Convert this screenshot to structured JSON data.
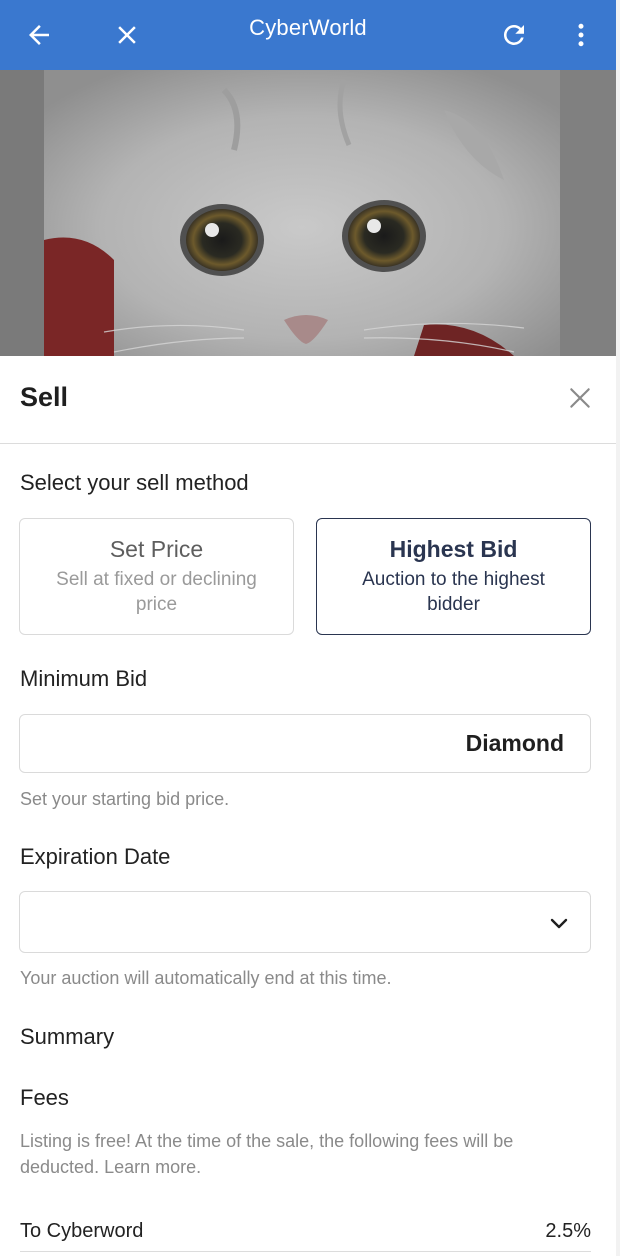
{
  "app_bar": {
    "title": "CyberWorld",
    "color": "#3a78cf",
    "icons": [
      "back-arrow-icon",
      "close-icon",
      "refresh-icon",
      "more-vertical-icon"
    ]
  },
  "hero": {
    "image": "white-kitten-photo"
  },
  "sell_sheet": {
    "title": "Sell",
    "method_prompt": "Select your sell method",
    "methods": [
      {
        "title": "Set Price",
        "subtitle": "Sell at fixed or declining price",
        "selected": false
      },
      {
        "title": "Highest Bid",
        "subtitle": "Auction to the highest bidder",
        "selected": true
      }
    ],
    "minimum_bid": {
      "label": "Minimum Bid",
      "value": "",
      "currency": "Diamond",
      "helper": "Set your starting bid price."
    },
    "expiration": {
      "label": "Expiration Date",
      "value": "",
      "helper": "Your auction will automatically end at this time."
    },
    "summary": {
      "heading": "Summary",
      "fees_heading": "Fees",
      "fees_note": "Listing is free! At the time of the sale, the following fees will be deducted. Learn more.",
      "fees": [
        {
          "name": "To Cyberword",
          "value": "2.5%"
        }
      ]
    }
  }
}
